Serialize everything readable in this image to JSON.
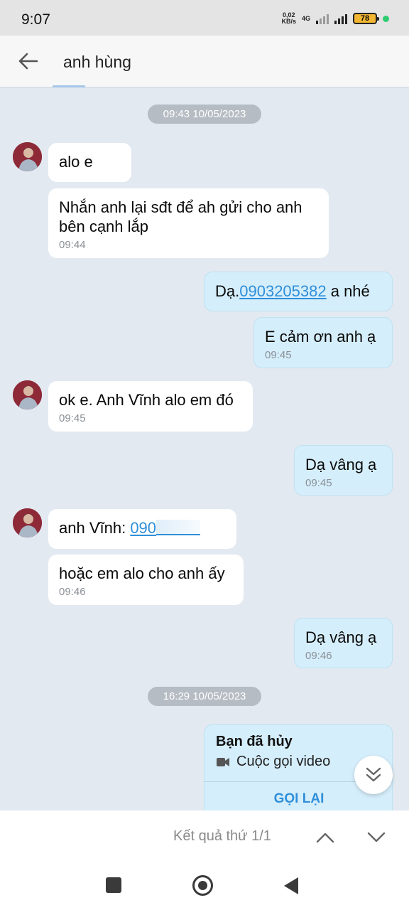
{
  "status_bar": {
    "time": "9:07",
    "net_speed": "0,02",
    "net_unit": "KB/s",
    "network": "4G",
    "battery": "78"
  },
  "header": {
    "title": "anh hùng"
  },
  "timestamps": [
    "09:43 10/05/2023",
    "16:29 10/05/2023"
  ],
  "messages": [
    {
      "text": "alo e"
    },
    {
      "text": "Nhắn anh lại sđt để ah gửi cho anh bên cạnh  lắp",
      "time": "09:44"
    },
    {
      "prefix": "Dạ.",
      "link": "0903205382",
      "suffix": " a nhé"
    },
    {
      "text": "E cảm ơn anh ạ",
      "time": "09:45"
    },
    {
      "text": "ok e. Anh Vĩnh alo em đó",
      "time": "09:45"
    },
    {
      "text": "Dạ vâng ạ",
      "time": "09:45"
    },
    {
      "prefix": "anh Vĩnh: ",
      "link": "090"
    },
    {
      "text": "hoặc em alo cho anh ấy",
      "time": "09:46"
    },
    {
      "text": "Dạ vâng ạ",
      "time": "09:46"
    }
  ],
  "call_card": {
    "title": "Bạn đã hủy",
    "subtitle": "Cuộc gọi video",
    "action": "GỌI LẠI"
  },
  "search_nav": {
    "result": "Kết quả thứ 1/1"
  }
}
